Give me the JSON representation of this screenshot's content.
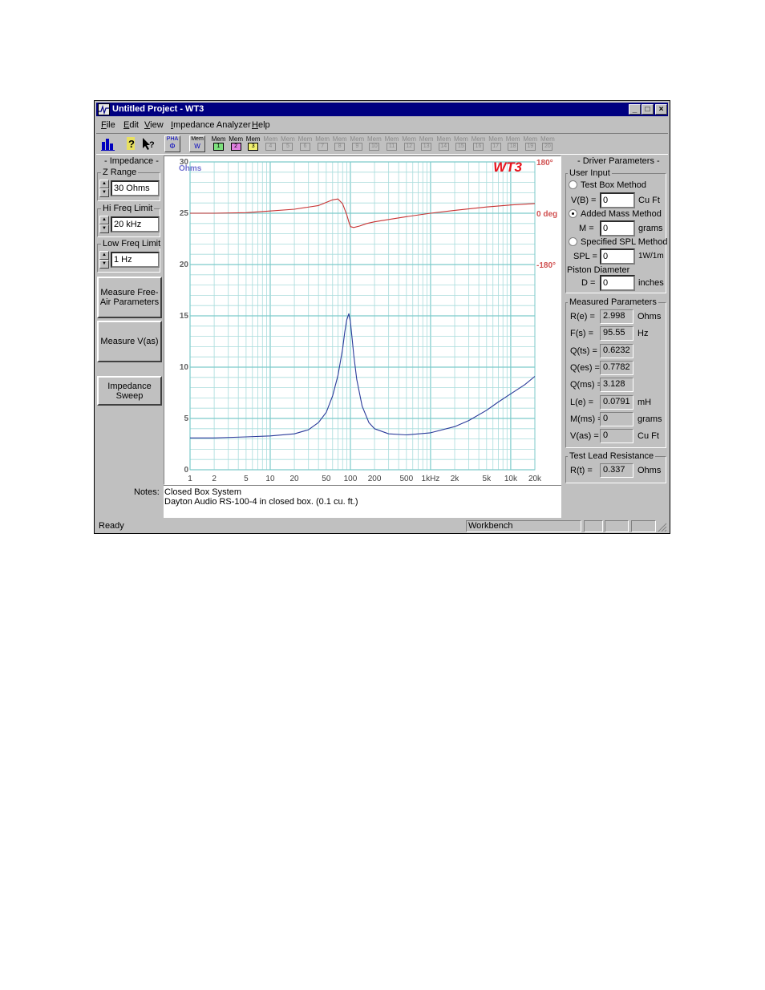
{
  "window": {
    "title": "Untitled Project - WT3",
    "controls": [
      "_",
      "□",
      "×"
    ]
  },
  "menu": [
    "File",
    "Edit",
    "View",
    "Impedance Analyzer",
    "Help"
  ],
  "toolbar": {
    "pha_label": "PHA",
    "pha_sub": "Φ",
    "mem_w_top": "Mem",
    "mem_w_sub": "W",
    "memories": [
      {
        "top": "Mem",
        "num": "1",
        "enabled": true,
        "color": "#7de07d"
      },
      {
        "top": "Mem",
        "num": "2",
        "enabled": true,
        "color": "#e080e0"
      },
      {
        "top": "Mem",
        "num": "3",
        "enabled": true,
        "color": "#f0f070"
      },
      {
        "top": "Mem",
        "num": "4",
        "enabled": false
      },
      {
        "top": "Mem",
        "num": "5",
        "enabled": false
      },
      {
        "top": "Mem",
        "num": "6",
        "enabled": false
      },
      {
        "top": "Mem",
        "num": "7",
        "enabled": false
      },
      {
        "top": "Mem",
        "num": "8",
        "enabled": false
      },
      {
        "top": "Mem",
        "num": "9",
        "enabled": false
      },
      {
        "top": "Mem",
        "num": "10",
        "enabled": false
      },
      {
        "top": "Mem",
        "num": "11",
        "enabled": false
      },
      {
        "top": "Mem",
        "num": "12",
        "enabled": false
      },
      {
        "top": "Mem",
        "num": "13",
        "enabled": false
      },
      {
        "top": "Mem",
        "num": "14",
        "enabled": false
      },
      {
        "top": "Mem",
        "num": "15",
        "enabled": false
      },
      {
        "top": "Mem",
        "num": "16",
        "enabled": false
      },
      {
        "top": "Mem",
        "num": "17",
        "enabled": false
      },
      {
        "top": "Mem",
        "num": "18",
        "enabled": false
      },
      {
        "top": "Mem",
        "num": "19",
        "enabled": false
      },
      {
        "top": "Mem",
        "num": "20",
        "enabled": false
      }
    ]
  },
  "left_panel": {
    "heading": "- Impedance -",
    "z_range": {
      "label": "Z Range",
      "value": "30 Ohms"
    },
    "hi_freq": {
      "label": "Hi Freq Limit",
      "value": "20 kHz"
    },
    "low_freq": {
      "label": "Low Freq Limit",
      "value": "1 Hz"
    },
    "btn_measure_free_air": "Measure Free-Air Parameters",
    "btn_measure_vas": "Measure V(as)",
    "btn_impedance_sweep": "Impedance Sweep"
  },
  "right_panel": {
    "heading": "- Driver Parameters -",
    "user_input": {
      "label": "User Input",
      "test_box": "Test Box Method",
      "vb_label": "V(B) =",
      "vb_value": "0",
      "vb_unit": "Cu Ft",
      "added_mass": "Added Mass Method",
      "m_label": "M =",
      "m_value": "0",
      "m_unit": "grams",
      "spl_method": "Specified SPL Method",
      "spl_label": "SPL =",
      "spl_value": "0",
      "spl_unit": "1W/1m",
      "piston": "Piston Diameter",
      "d_label": "D =",
      "d_value": "0",
      "d_unit": "inches",
      "selected": "added_mass"
    },
    "measured": {
      "label": "Measured Parameters",
      "rows": [
        {
          "name": "R(e) =",
          "value": "2.998",
          "unit": "Ohms"
        },
        {
          "name": "F(s) =",
          "value": "95.55",
          "unit": "Hz"
        },
        {
          "name": "Q(ts) =",
          "value": "0.6232",
          "unit": ""
        },
        {
          "name": "Q(es) =",
          "value": "0.7782",
          "unit": ""
        },
        {
          "name": "Q(ms) =",
          "value": "3.128",
          "unit": ""
        },
        {
          "name": "L(e) =",
          "value": "0.0791",
          "unit": "mH"
        },
        {
          "name": "M(ms) =",
          "value": "0",
          "unit": "grams"
        },
        {
          "name": "V(as) =",
          "value": "0",
          "unit": "Cu Ft"
        }
      ]
    },
    "test_lead": {
      "label": "Test Lead Resistance",
      "name": "R(t) =",
      "value": "0.337",
      "unit": "Ohms"
    }
  },
  "notes": {
    "label": "Notes:",
    "line1": "Closed Box System",
    "line2": "Dayton Audio RS-100-4 in closed box. (0.1 cu. ft.)"
  },
  "status": {
    "left": "Ready",
    "mode": "Workbench"
  },
  "chart_data": {
    "type": "line",
    "logo": "WT3",
    "left_axis_unit": "Ohms",
    "x_scale": "log",
    "xlim": [
      1,
      20000
    ],
    "x_ticks": [
      {
        "v": 1,
        "label": "1"
      },
      {
        "v": 2,
        "label": "2"
      },
      {
        "v": 5,
        "label": "5"
      },
      {
        "v": 10,
        "label": "10"
      },
      {
        "v": 20,
        "label": "20"
      },
      {
        "v": 50,
        "label": "50"
      },
      {
        "v": 100,
        "label": "100"
      },
      {
        "v": 200,
        "label": "200"
      },
      {
        "v": 500,
        "label": "500"
      },
      {
        "v": 1000,
        "label": "1kHz"
      },
      {
        "v": 2000,
        "label": "2k"
      },
      {
        "v": 5000,
        "label": "5k"
      },
      {
        "v": 10000,
        "label": "10k"
      },
      {
        "v": 20000,
        "label": "20k"
      }
    ],
    "ylim": [
      0,
      30
    ],
    "y_ticks": [
      0,
      5,
      10,
      15,
      20,
      25,
      30
    ],
    "phase_labels": [
      {
        "v": 180,
        "label": "180°"
      },
      {
        "v": 0,
        "label": "0 deg"
      },
      {
        "v": -180,
        "label": "-180°"
      }
    ],
    "phase_axis": {
      "top_ohms": 30,
      "zero_ohms": 25,
      "bottom_ohms": 20
    },
    "grid": true,
    "colors": {
      "impedance": "#2a3a9a",
      "phase": "#c83232",
      "grid": "#a8dcdc",
      "grid_major": "#7ccaca",
      "logo": "#e8141e",
      "ohms": "#7070d0",
      "phase_text": "#d05050"
    },
    "series": [
      {
        "name": "Impedance",
        "unit": "Ohms",
        "x": [
          1,
          2,
          5,
          10,
          20,
          30,
          40,
          50,
          60,
          70,
          80,
          85,
          90,
          95.55,
          100,
          105,
          110,
          120,
          140,
          170,
          200,
          300,
          500,
          1000,
          2000,
          3000,
          5000,
          7000,
          10000,
          15000,
          20000
        ],
        "y": [
          3.1,
          3.1,
          3.2,
          3.3,
          3.5,
          3.9,
          4.6,
          5.6,
          7.2,
          9.2,
          11.8,
          13.4,
          14.6,
          15.2,
          14.4,
          12.8,
          11.2,
          8.8,
          6.2,
          4.6,
          4.0,
          3.5,
          3.4,
          3.6,
          4.2,
          4.8,
          5.8,
          6.6,
          7.4,
          8.3,
          9.1
        ]
      },
      {
        "name": "Phase",
        "unit": "deg",
        "x": [
          1,
          2,
          5,
          10,
          20,
          40,
          60,
          70,
          80,
          90,
          95.55,
          100,
          110,
          130,
          160,
          200,
          300,
          500,
          1000,
          2000,
          5000,
          10000,
          20000
        ],
        "y": [
          0,
          0,
          2,
          8,
          14,
          27,
          47,
          50,
          33,
          -5,
          -30,
          -47,
          -50,
          -45,
          -36,
          -30,
          -22,
          -12,
          0,
          10,
          22,
          29,
          34
        ]
      }
    ]
  }
}
